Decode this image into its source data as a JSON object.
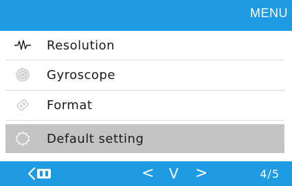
{
  "header": {
    "title": "MENU"
  },
  "menu": {
    "items": [
      {
        "label": "Resolution",
        "icon": "waveform-icon"
      },
      {
        "label": "Gyroscope",
        "icon": "gyroscope-icon"
      },
      {
        "label": "Format",
        "icon": "format-icon"
      },
      {
        "label": "Default setting",
        "icon": "settings-icon",
        "selected": true
      }
    ]
  },
  "footer": {
    "back_icon": "back-icon",
    "prev_label": "<",
    "down_label": "V",
    "next_label": ">",
    "page_indicator": "4/5"
  },
  "colors": {
    "header_bg": "#1f9be4",
    "selected_row": "#c3c3c3"
  }
}
